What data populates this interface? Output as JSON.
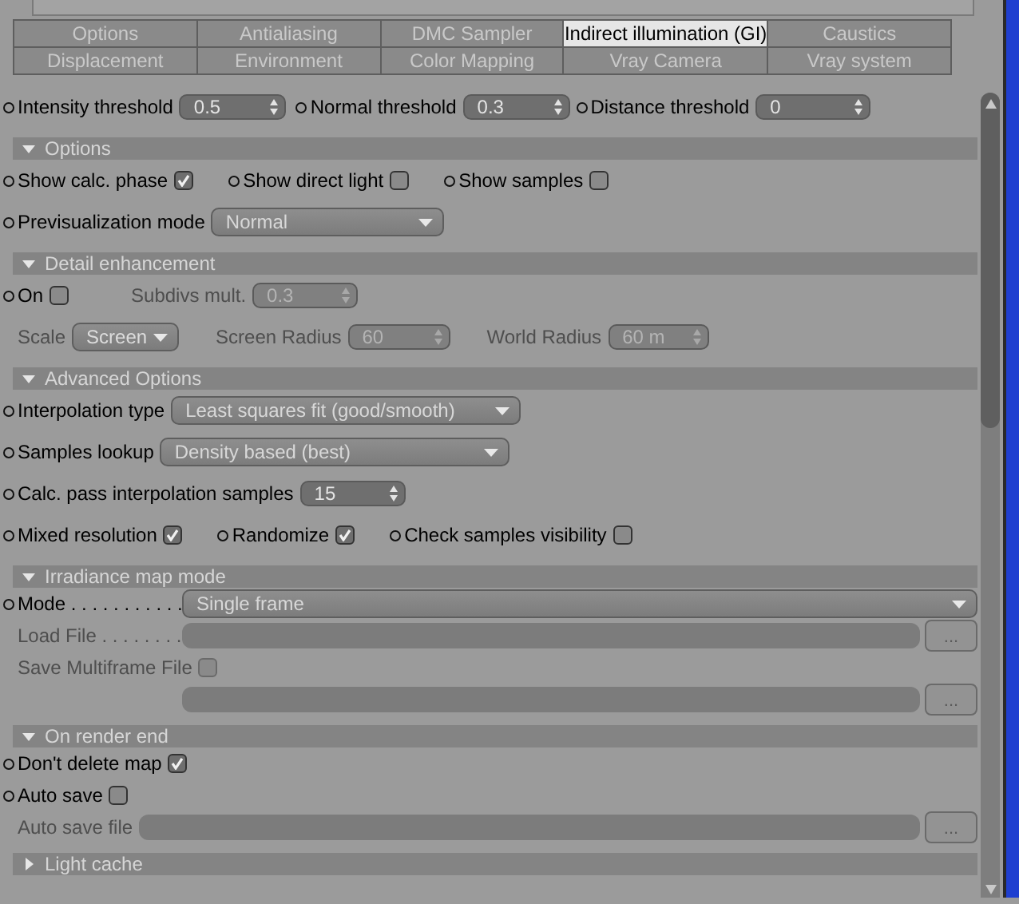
{
  "tabs": [
    {
      "label": "Options",
      "selected": false
    },
    {
      "label": "Antialiasing",
      "selected": false
    },
    {
      "label": "DMC Sampler",
      "selected": false
    },
    {
      "label": "Indirect illumination (GI)",
      "selected": true
    },
    {
      "label": "Caustics",
      "selected": false
    },
    {
      "label": "Displacement",
      "selected": false
    },
    {
      "label": "Environment",
      "selected": false
    },
    {
      "label": "Color Mapping",
      "selected": false
    },
    {
      "label": "Vray Camera",
      "selected": false
    },
    {
      "label": "Vray system",
      "selected": false
    }
  ],
  "sections": [
    {
      "rows": [
        {
          "items": [
            {
              "kind": "spinner",
              "label": "Intensity threshold",
              "value": "0.5",
              "dot": true,
              "disabled": false
            },
            {
              "kind": "spinner",
              "label": "Normal threshold",
              "value": "0.3",
              "dot": true,
              "disabled": false
            },
            {
              "kind": "spinner",
              "label": "Distance threshold",
              "value": "0",
              "dot": true,
              "disabled": false
            }
          ]
        }
      ]
    },
    {
      "header": "Options",
      "expanded": true,
      "rows": [
        {
          "items": [
            {
              "kind": "checkbox",
              "label": "Show calc. phase",
              "checked": true,
              "dot": true,
              "disabled": false
            },
            {
              "kind": "checkbox",
              "label": "Show direct light",
              "checked": false,
              "dot": true,
              "disabled": false
            },
            {
              "kind": "checkbox",
              "label": "Show samples",
              "checked": false,
              "dot": true,
              "disabled": false
            }
          ]
        },
        {
          "items": [
            {
              "kind": "dropdown",
              "label": "Previsualization mode",
              "value": "Normal",
              "dot": true,
              "disabled": false
            }
          ]
        }
      ]
    },
    {
      "header": "Detail enhancement",
      "expanded": true,
      "rows": [
        {
          "items": [
            {
              "kind": "checkbox",
              "label": "On",
              "checked": false,
              "dot": true,
              "disabled": false
            },
            {
              "kind": "spinner",
              "label": "Subdivs mult.",
              "value": "0.3",
              "dot": false,
              "disabled": true
            }
          ]
        },
        {
          "items": [
            {
              "kind": "dropdown",
              "label": "Scale",
              "value": "Screen",
              "dot": false,
              "disabled": true
            },
            {
              "kind": "spinner",
              "label": "Screen Radius",
              "value": "60",
              "dot": false,
              "disabled": true
            },
            {
              "kind": "spinner",
              "label": "World Radius",
              "value": "60 m",
              "dot": false,
              "disabled": true
            }
          ]
        }
      ]
    },
    {
      "header": "Advanced Options",
      "expanded": true,
      "rows": [
        {
          "items": [
            {
              "kind": "dropdown",
              "label": "Interpolation type",
              "value": "Least squares fit (good/smooth)",
              "dot": true,
              "disabled": false
            }
          ]
        },
        {
          "items": [
            {
              "kind": "dropdown",
              "label": "Samples lookup",
              "value": "Density based (best)",
              "dot": true,
              "disabled": false
            }
          ]
        },
        {
          "items": [
            {
              "kind": "spinner",
              "label": "Calc. pass interpolation samples",
              "value": "15",
              "dot": true,
              "disabled": false
            }
          ]
        },
        {
          "items": [
            {
              "kind": "checkbox",
              "label": "Mixed resolution",
              "checked": true,
              "dot": true,
              "disabled": false
            },
            {
              "kind": "checkbox",
              "label": "Randomize",
              "checked": true,
              "dot": true,
              "disabled": false
            },
            {
              "kind": "checkbox",
              "label": "Check samples visibility",
              "checked": false,
              "dot": true,
              "disabled": false
            }
          ]
        }
      ]
    },
    {
      "header": "Irradiance map mode",
      "expanded": true,
      "rows": [
        {
          "items": [
            {
              "kind": "dropdown",
              "label": "Mode . . . . . . . . . . .",
              "value": "Single frame",
              "dot": true,
              "disabled": false
            }
          ]
        },
        {
          "items": [
            {
              "kind": "file",
              "label": "Load File . . . . . . . .",
              "browse": "...",
              "dot": false,
              "disabled": true
            }
          ]
        },
        {
          "items": [
            {
              "kind": "checkbox",
              "label": "Save Multiframe File",
              "checked": false,
              "dot": false,
              "disabled": true
            }
          ]
        },
        {
          "items": [
            {
              "kind": "file",
              "browse": "...",
              "dot": false,
              "disabled": true
            }
          ]
        }
      ]
    },
    {
      "header": "On render end",
      "expanded": true,
      "rows": [
        {
          "items": [
            {
              "kind": "checkbox",
              "label": "Don't delete map",
              "checked": true,
              "dot": true,
              "disabled": false
            }
          ]
        },
        {
          "items": [
            {
              "kind": "checkbox",
              "label": "Auto save",
              "checked": false,
              "dot": true,
              "disabled": false
            }
          ]
        },
        {
          "items": [
            {
              "kind": "file",
              "label": "Auto save file",
              "browse": "...",
              "dot": false,
              "disabled": true
            }
          ]
        }
      ]
    },
    {
      "header": "Light cache",
      "expanded": false
    }
  ]
}
